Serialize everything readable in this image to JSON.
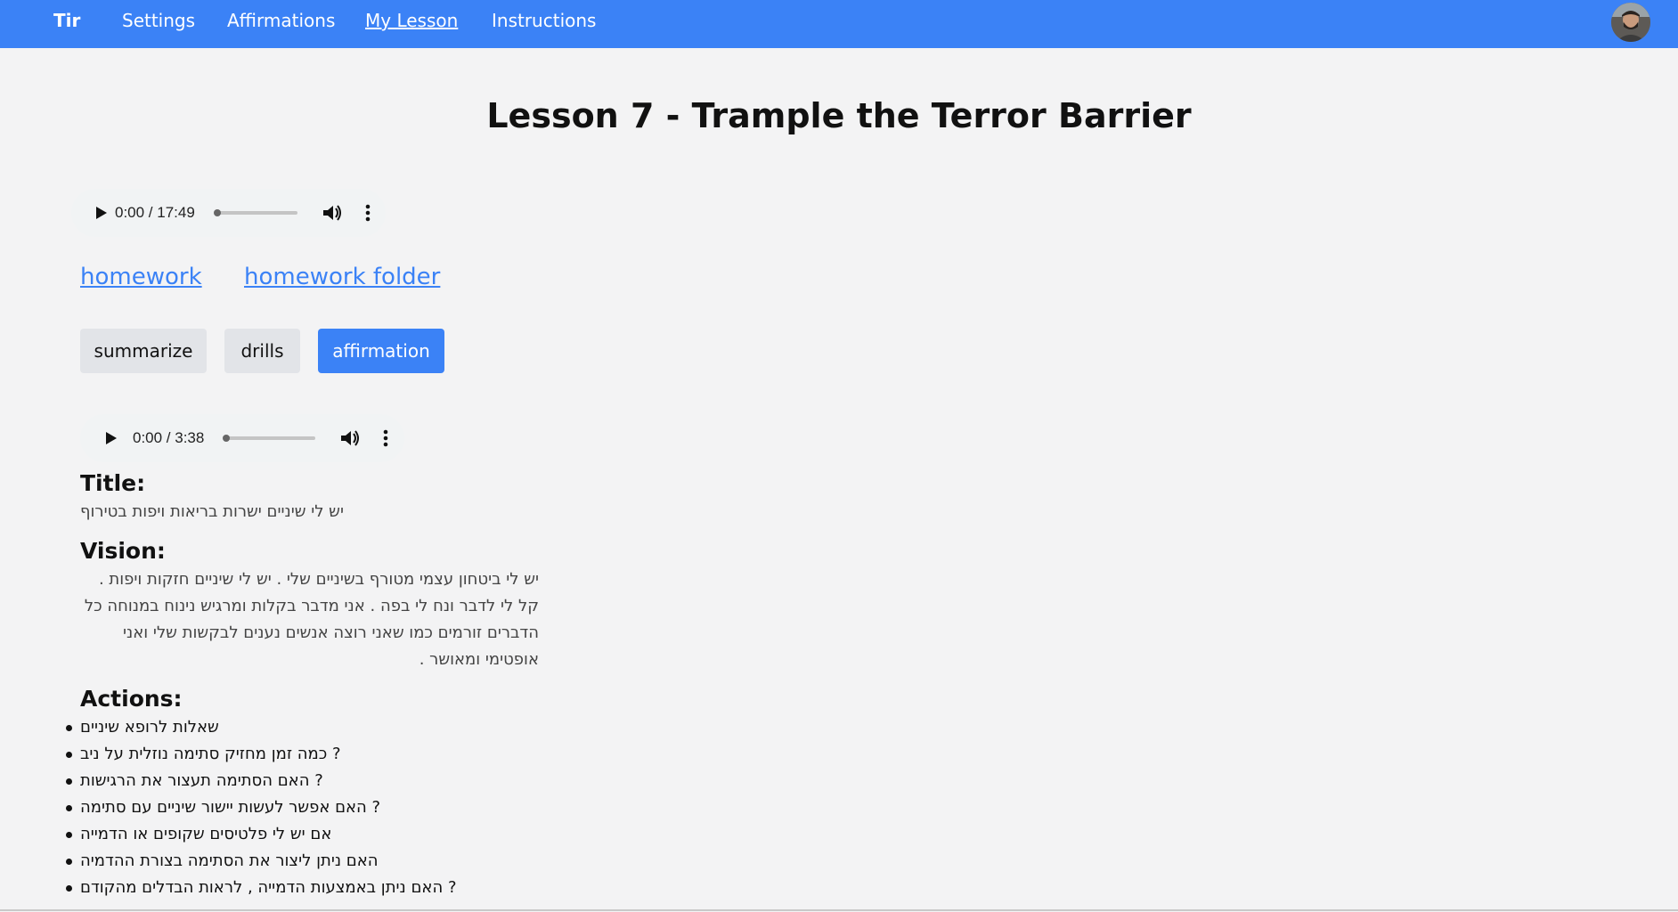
{
  "nav": {
    "brand": "Tir",
    "links": [
      "Settings",
      "Affirmations",
      "My Lesson",
      "Instructions"
    ],
    "active": "My Lesson"
  },
  "page": {
    "title": "Lesson 7 - Trample the Terror Barrier"
  },
  "audio1": {
    "time": "0:00 / 17:49",
    "progress": 0
  },
  "audio2": {
    "time": "0:00 / 3:38",
    "progress": 0
  },
  "links": {
    "homework": "homework",
    "homework_folder": "homework folder"
  },
  "buttons": {
    "summarize": "summarize",
    "drills": "drills",
    "affirmation": "affirmation",
    "selected": "affirmation"
  },
  "affirmation": {
    "title_heading": "Title:",
    "title_text": "יש לי שיניים ישרות בריאות ויפות בטירוף",
    "vision_heading": "Vision:",
    "vision_text": "יש לי ביטחון עצמי מטורף בשיניים שלי . יש לי שיניים חזקות ויפות . קל לי לדבר ונח לי בפה . אני מדבר בקלות ומרגיש נינוח במנוחה כל הדברים זורמים כמו שאני רוצה אנשים נענים לבקשות שלי ואני אופטימי ומאושר .",
    "actions_heading": "Actions:",
    "actions": [
      "שאלות לרופא שיניים",
      "כמה זמן מחזיק סתימה נוזלית על ניב ?",
      "האם הסתימה תעצור את הרגישות ?",
      "האם אפשר לעשות יישור שיניים עם סתימה ?",
      "אם יש לי פלטיסים שקופים או הדמייה",
      "האם ניתן ליצור את הסתימה בצורת ההדמיה",
      "האם ניתן באמצעות הדמייה , לראות הבדלים מהקודם ?"
    ]
  },
  "colors": {
    "navbar": "#3b82f6",
    "link": "#3b82f6",
    "selected_button": "#3b82f6",
    "button": "#e2e4e8",
    "background": "#f3f3f4"
  }
}
